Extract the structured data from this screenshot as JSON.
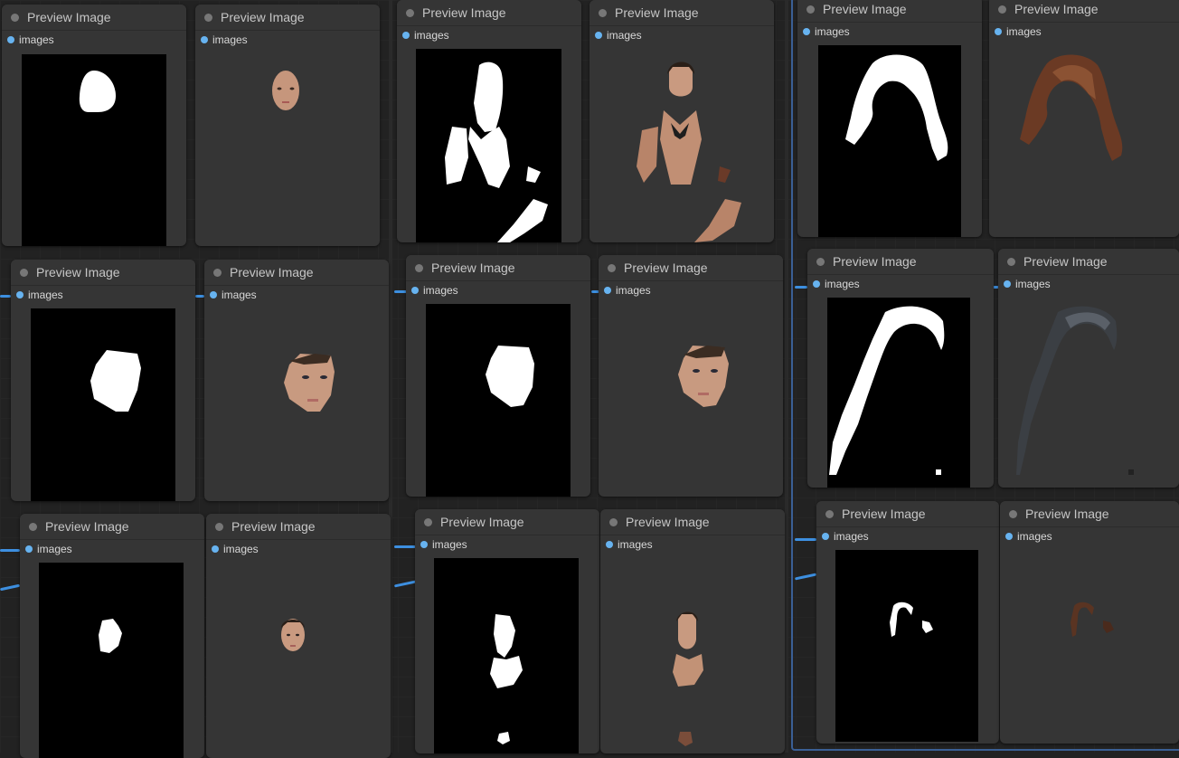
{
  "node_title": "Preview Image",
  "slot_label": "images",
  "colors": {
    "canvas": "#222222",
    "node": "#353535",
    "slot_dot": "#67b3f0",
    "wire": "#3d8fe0",
    "group_border": "#3a5f95"
  },
  "icons": {
    "node_collapse": "circle-dot-icon",
    "slot": "input-slot-icon"
  }
}
